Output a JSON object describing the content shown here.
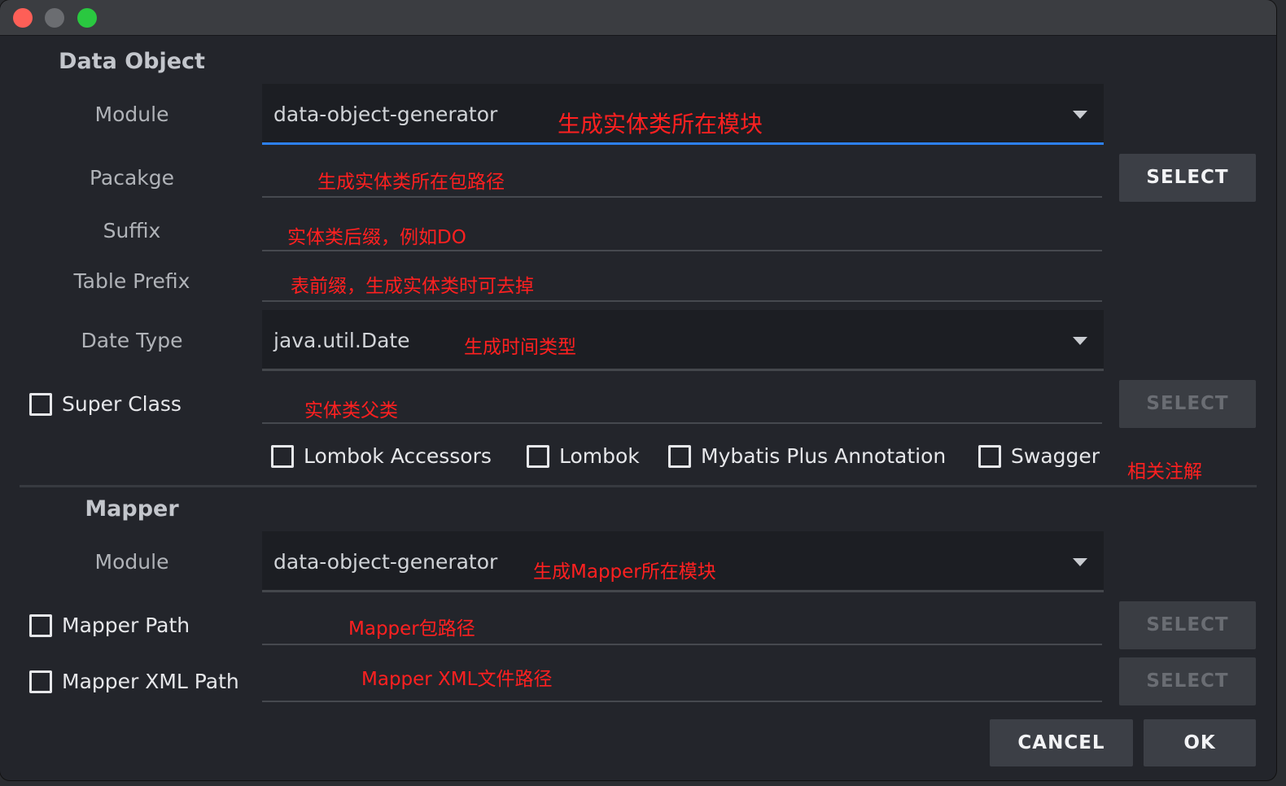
{
  "data_object": {
    "section_title": "Data Object",
    "module": {
      "label": "Module",
      "value": "data-object-generator",
      "note": "生成实体类所在模块"
    },
    "package": {
      "label": "Pacakge",
      "note": "生成实体类所在包路径",
      "button": "SELECT"
    },
    "suffix": {
      "label": "Suffix",
      "note": "实体类后缀，例如DO"
    },
    "table_prefix": {
      "label": "Table Prefix",
      "note": "表前缀，生成实体类时可去掉"
    },
    "date_type": {
      "label": "Date Type",
      "value": "java.util.Date",
      "note": "生成时间类型"
    },
    "super_class": {
      "label": "Super Class",
      "checked": false,
      "note": "实体类父类",
      "button": "SELECT"
    },
    "options": [
      {
        "label": "Lombok Accessors",
        "checked": false
      },
      {
        "label": "Lombok",
        "checked": false
      },
      {
        "label": "Mybatis Plus Annotation",
        "checked": false
      },
      {
        "label": "Swagger",
        "checked": false
      }
    ],
    "options_note": "相关注解"
  },
  "mapper": {
    "section_title": "Mapper",
    "module": {
      "label": "Module",
      "value": "data-object-generator",
      "note": "生成Mapper所在模块"
    },
    "mapper_path": {
      "label": "Mapper Path",
      "checked": false,
      "note": "Mapper包路径",
      "button": "SELECT"
    },
    "mapper_xml_path": {
      "label": "Mapper XML Path",
      "checked": false,
      "note": "Mapper XML文件路径",
      "button": "SELECT"
    }
  },
  "footer": {
    "cancel": "CANCEL",
    "ok": "OK"
  },
  "colors": {
    "accent": "#2d80f2",
    "note": "#ff2020",
    "background": "#23252b"
  },
  "icons": [
    "close-light",
    "minimize-light",
    "maximize-light",
    "chevron-down-icon",
    "checkbox-icon"
  ]
}
